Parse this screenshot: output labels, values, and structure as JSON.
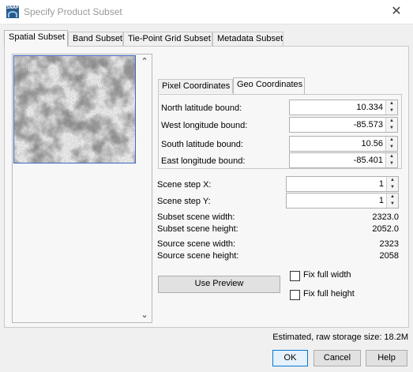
{
  "window": {
    "title": "Specify Product Subset",
    "icon_text": "SNAP"
  },
  "tabs": [
    "Spatial Subset",
    "Band Subset",
    "Tie-Point Grid Subset",
    "Metadata Subset"
  ],
  "coord_tabs": [
    "Pixel Coordinates",
    "Geo Coordinates"
  ],
  "geo": {
    "north_label": "North latitude bound:",
    "north_value": "10.334",
    "west_label": "West longitude bound:",
    "west_value": "-85.573",
    "south_label": "South latitude bound:",
    "south_value": "10.56",
    "east_label": "East longitude bound:",
    "east_value": "-85.401"
  },
  "scene": {
    "step_x_label": "Scene step X:",
    "step_x_value": "1",
    "step_y_label": "Scene step Y:",
    "step_y_value": "1",
    "subset_width_label": "Subset scene width:",
    "subset_width_value": "2323.0",
    "subset_height_label": "Subset scene height:",
    "subset_height_value": "2052.0",
    "source_width_label": "Source scene width:",
    "source_width_value": "2323",
    "source_height_label": "Source scene height:",
    "source_height_value": "2058"
  },
  "buttons": {
    "use_preview": "Use Preview",
    "ok": "OK",
    "cancel": "Cancel",
    "help": "Help"
  },
  "checkboxes": {
    "fix_width": "Fix full width",
    "fix_height": "Fix full height"
  },
  "storage": "Estimated, raw storage size: 18.2M",
  "colors": {
    "accent": "#0078d7",
    "preview_border": "#3b68c9"
  }
}
